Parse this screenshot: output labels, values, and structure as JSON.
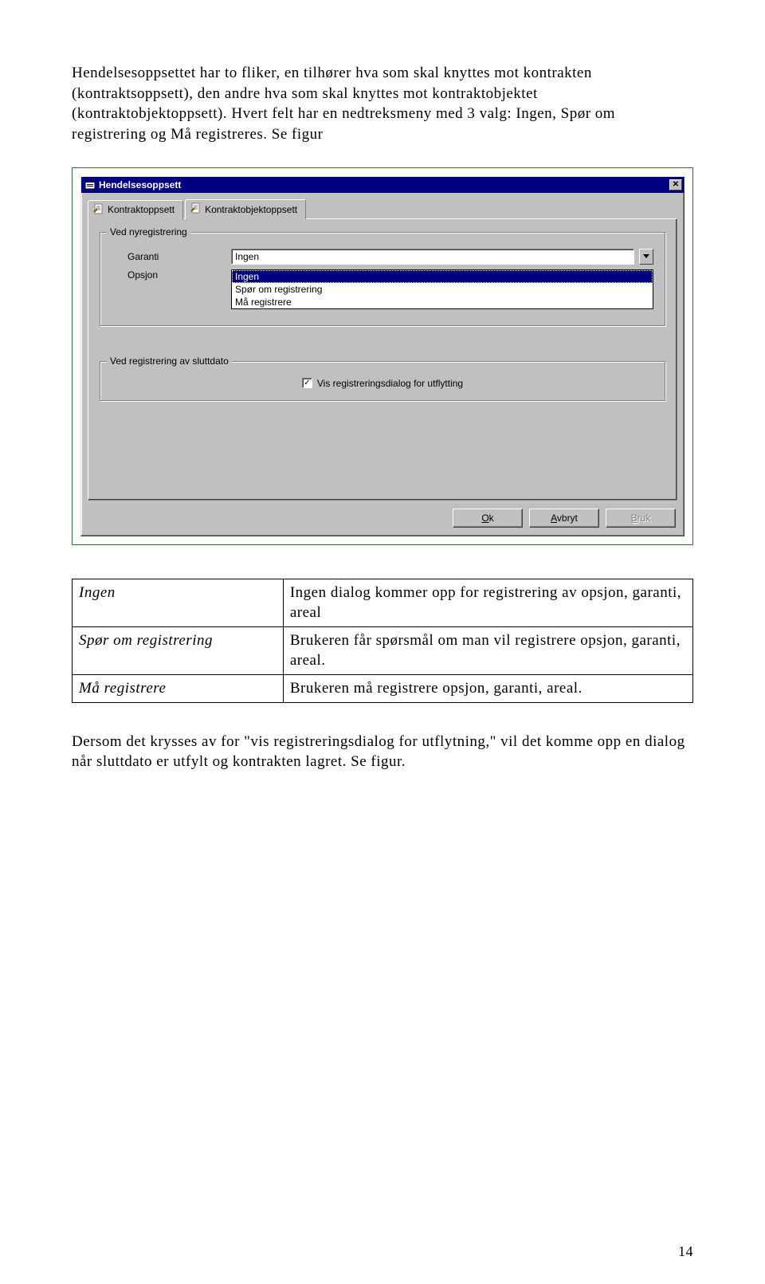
{
  "paragraphs": {
    "intro": "Hendelsesoppsettet har to fliker, en tilhører hva som skal knyttes mot kontrakten (kontraktsoppsett), den andre hva som skal knyttes mot kontraktobjektet (kontraktobjektoppsett). Hvert felt har en nedtreksmeny med 3 valg: Ingen, Spør om registrering og Må registreres. Se figur",
    "outro": "Dersom det krysses av for \"vis registreringsdialog for utflytning,\" vil det komme opp en dialog når sluttdato er utfylt og kontrakten lagret. Se figur."
  },
  "dialog": {
    "title": "Hendelsesoppsett",
    "tabs": {
      "active": "Kontraktoppsett",
      "inactive": "Kontraktobjektoppsett"
    },
    "group1": {
      "legend": "Ved nyregistrering",
      "field1_label": "Garanti",
      "field1_value": "Ingen",
      "field2_label": "Opsjon",
      "dropdown_options": [
        "Ingen",
        "Spør om registrering",
        "Må registrere"
      ],
      "dropdown_selected": "Ingen"
    },
    "group2": {
      "legend": "Ved registrering av sluttdato",
      "checkbox_label": "Vis registreringsdialog for utflytting",
      "checkbox_checked": true
    },
    "buttons": {
      "ok": "Ok",
      "cancel": "Avbryt",
      "apply": "Bruk"
    }
  },
  "definitions": [
    {
      "term": "Ingen",
      "desc": "Ingen dialog kommer opp for registrering av opsjon, garanti, areal"
    },
    {
      "term": "Spør om registrering",
      "desc": "Brukeren får spørsmål om man vil registrere opsjon, garanti, areal."
    },
    {
      "term": "Må registrere",
      "desc": "Brukeren må registrere opsjon, garanti, areal."
    }
  ],
  "page_number": "14"
}
